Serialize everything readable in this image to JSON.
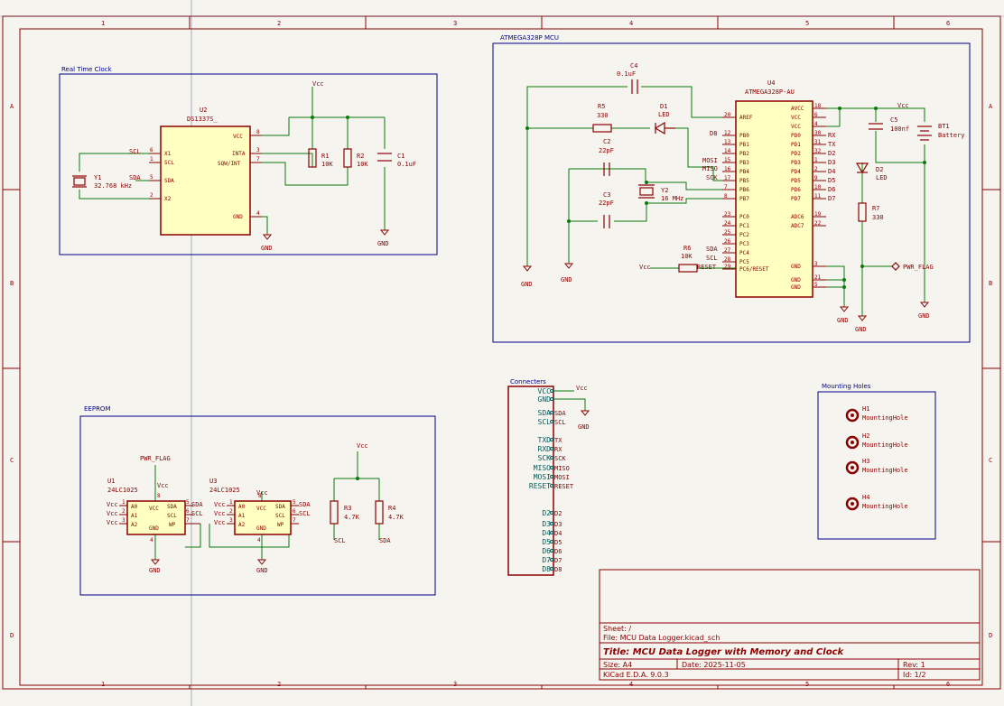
{
  "frame": {
    "cols": [
      "1",
      "2",
      "3",
      "4",
      "5",
      "6"
    ],
    "rows": [
      "A",
      "B",
      "C",
      "D"
    ]
  },
  "sheets": {
    "rtc": "Real Time Clock",
    "mcu": "ATMEGA328P MCU",
    "eeprom": "EEPROM",
    "conn": "Connecters",
    "mount": "Mounting Holes"
  },
  "rtc": {
    "u2_ref": "U2",
    "u2_val": "DS1337S_",
    "pin_vcc": "VCC",
    "pin_inta": "INTA",
    "pin_sqw": "SQW/INT",
    "pin_gnd": "GND",
    "pin_x1": "X1",
    "pin_x2": "X2",
    "pin_scl": "SCL",
    "pin_sda": "SDA",
    "n8": "8",
    "n3": "3",
    "n7": "7",
    "n4": "4",
    "n6": "6",
    "n1": "1",
    "n5": "5",
    "n2": "2",
    "scl": "SCL",
    "sda": "SDA",
    "y1_ref": "Y1",
    "y1_val": "32.768 kHz",
    "r1_ref": "R1",
    "r1_val": "10K",
    "r2_ref": "R2",
    "r2_val": "10K",
    "c1_ref": "C1",
    "c1_val": "0.1uF",
    "vcc": "Vcc",
    "gnd1": "GND",
    "gnd2": "GND"
  },
  "mcu": {
    "u4_ref": "U4",
    "u4_val": "ATMEGA328P-AU",
    "left_pins": [
      [
        "AREF",
        "20"
      ],
      [
        "PB0",
        "12"
      ],
      [
        "PB1",
        "13"
      ],
      [
        "PB2",
        "14"
      ],
      [
        "PB3",
        "15"
      ],
      [
        "PB4",
        "16"
      ],
      [
        "PB5",
        "17"
      ],
      [
        "PB6",
        "7"
      ],
      [
        "PB7",
        "8"
      ],
      [
        "PC0",
        "23"
      ],
      [
        "PC1",
        "24"
      ],
      [
        "PC2",
        "25"
      ],
      [
        "PC3",
        "26"
      ],
      [
        "PC4",
        "27"
      ],
      [
        "PC5",
        "28"
      ],
      [
        "PC6/RESET",
        "29"
      ]
    ],
    "right_pins": [
      [
        "AVCC",
        "18"
      ],
      [
        "VCC",
        "6"
      ],
      [
        "VCC",
        "4"
      ],
      [
        "PD0",
        "30"
      ],
      [
        "PD1",
        "31"
      ],
      [
        "PD2",
        "32"
      ],
      [
        "PD3",
        "1"
      ],
      [
        "PD4",
        "2"
      ],
      [
        "PD5",
        "9"
      ],
      [
        "PD6",
        "10"
      ],
      [
        "PD7",
        "11"
      ],
      [
        "ADC6",
        "19"
      ],
      [
        "ADC7",
        "22"
      ],
      [
        "GND",
        "3"
      ],
      [
        "GND",
        "21"
      ],
      [
        "GND",
        "5"
      ]
    ],
    "right_nets": [
      "RX",
      "TX",
      "D2",
      "D3",
      "D4",
      "D5",
      "D6",
      "D7"
    ],
    "left_nets": {
      "d8": "D8",
      "mosi": "MOSI",
      "miso": "MISO",
      "sck": "SCK",
      "sda": "SDA",
      "scl": "SCL",
      "reset": "RESET"
    },
    "c4_ref": "C4",
    "c4_val": "0.1uF",
    "r5_ref": "R5",
    "r5_val": "330",
    "d1_ref": "D1",
    "d1_val": "LED",
    "c2_ref": "C2",
    "c2_val": "22pF",
    "c3_ref": "C3",
    "c3_val": "22pF",
    "y2_ref": "Y2",
    "y2_val": "16 MHz",
    "r6_ref": "R6",
    "r6_val": "10K",
    "vcc": "Vcc",
    "vcc2": "Vcc",
    "c5_ref": "C5",
    "c5_val": "100nf",
    "bt1_ref": "BT1",
    "bt1_val": "Battery",
    "d2_ref": "D2",
    "d2_val": "LED",
    "r7_ref": "R7",
    "r7_val": "330",
    "pwr_flag": "PWR_FLAG",
    "gnd_a": "GND",
    "gnd_b": "GND",
    "gnd_c": "GND",
    "gnd_d": "GND",
    "gnd_e": "GND"
  },
  "eeprom": {
    "pwr_flag": "PWR_FLAG",
    "vcc": "Vcc",
    "vcc2": "Vcc",
    "u1_ref": "U1",
    "u1_val": "24LC1025",
    "u3_ref": "U3",
    "u3_val": "24LC1025",
    "pin_a0": "A0",
    "pin_a1": "A1",
    "pin_a2": "A2",
    "pin_vcc": "VCC",
    "pin_sda": "SDA",
    "pin_scl": "SCL",
    "pin_wp": "WP",
    "pin_gnd": "GND",
    "n1": "1",
    "n2": "2",
    "n3": "3",
    "n4": "4",
    "n5": "5",
    "n6": "6",
    "n7": "7",
    "n8": "8",
    "sda": "SDA",
    "scl": "SCL",
    "v1": "Vcc",
    "v2": "Vcc",
    "v3": "Vcc",
    "v4": "Vcc",
    "v5": "Vcc",
    "v6": "Vcc",
    "r3_ref": "R3",
    "r3_val": "4.7K",
    "r4_ref": "R4",
    "r4_val": "4.7K",
    "gnd1": "GND",
    "gnd2": "GND"
  },
  "conn": {
    "pins": [
      "VCC",
      "GND",
      "SDA",
      "SCL",
      "TXD",
      "RXD",
      "SCK",
      "MISO",
      "MOSI",
      "RESET",
      "D2",
      "D3",
      "D4",
      "D5",
      "D6",
      "D7",
      "D8"
    ],
    "nets": [
      "SDA",
      "SCL",
      "TX",
      "RX",
      "SCK",
      "MISO",
      "MOSI",
      "RESET",
      "D2",
      "D3",
      "D4",
      "D5",
      "D6",
      "D7",
      "D8"
    ],
    "vcc": "Vcc",
    "gnd": "GND"
  },
  "mount": {
    "holes": [
      [
        "H1",
        "MountingHole"
      ],
      [
        "H2",
        "MountingHole"
      ],
      [
        "H3",
        "MountingHole"
      ],
      [
        "H4",
        "MountingHole"
      ]
    ]
  },
  "title_block": {
    "sheet": "Sheet: /",
    "file": "File: MCU Data Logger.kicad_sch",
    "title": "Title: MCU Data Logger with Memory and Clock",
    "size": "Size: A4",
    "date": "Date: 2025-11-05",
    "rev": "Rev: 1",
    "tool": "KiCad E.D.A. 9.0.3",
    "id": "Id: 1/2"
  }
}
